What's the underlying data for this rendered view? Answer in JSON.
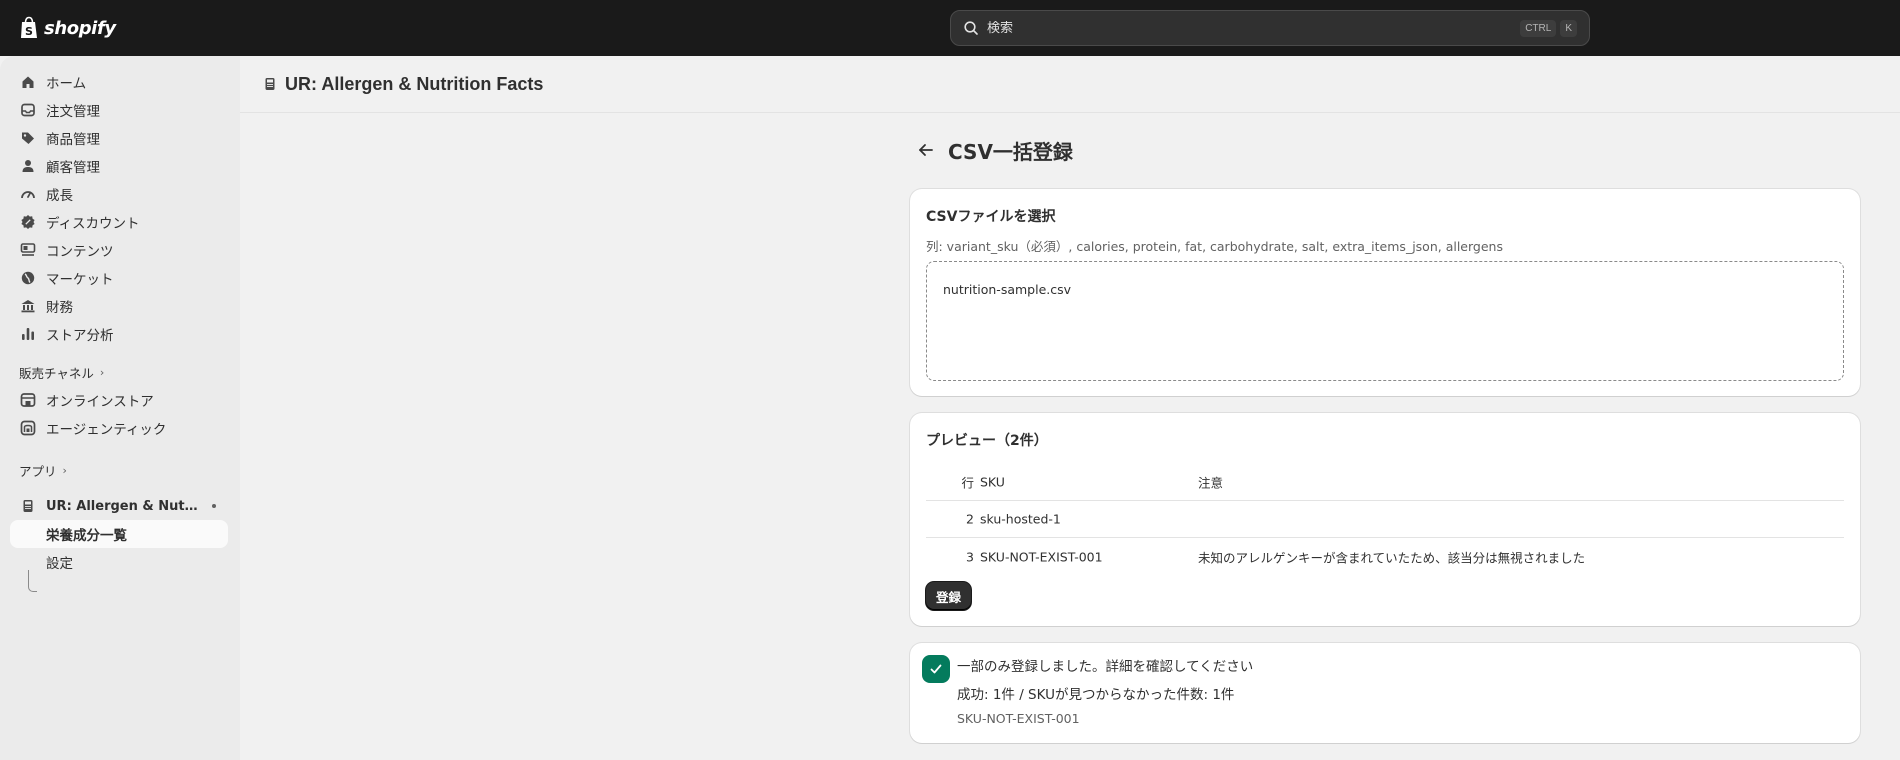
{
  "topbar": {
    "logo_text": "shopify",
    "search_placeholder": "検索",
    "shortcut_key1": "CTRL",
    "shortcut_key2": "K"
  },
  "sidebar": {
    "items": [
      {
        "label": "ホーム",
        "icon": "home-icon"
      },
      {
        "label": "注文管理",
        "icon": "inbox-icon"
      },
      {
        "label": "商品管理",
        "icon": "tag-icon"
      },
      {
        "label": "顧客管理",
        "icon": "person-icon"
      },
      {
        "label": "成長",
        "icon": "gauge-icon"
      },
      {
        "label": "ディスカウント",
        "icon": "discount-icon"
      },
      {
        "label": "コンテンツ",
        "icon": "content-icon"
      },
      {
        "label": "マーケット",
        "icon": "globe-icon"
      },
      {
        "label": "財務",
        "icon": "bank-icon"
      },
      {
        "label": "ストア分析",
        "icon": "bar-chart-icon"
      }
    ],
    "sales_channels_label": "販売チャネル",
    "channels": [
      {
        "label": "オンラインストア",
        "icon": "store-icon"
      },
      {
        "label": "エージェンティック",
        "icon": "agentic-icon"
      }
    ],
    "apps_label": "アプリ",
    "app": {
      "label": "UR: Allergen & Nutrition Facts",
      "icon": "app-icon"
    },
    "sub_items": [
      {
        "label": "栄養成分一覧"
      },
      {
        "label": "設定"
      }
    ]
  },
  "header": {
    "app_title": "UR: Allergen & Nutrition Facts"
  },
  "page": {
    "title": "CSV一括登録"
  },
  "upload_card": {
    "heading": "CSVファイルを選択",
    "columns_hint": "列: variant_sku（必須）, calories, protein, fat, carbohydrate, salt, extra_items_json, allergens",
    "file_name": "nutrition-sample.csv"
  },
  "preview_card": {
    "heading": "プレビュー（2件）",
    "columns": {
      "row": "行",
      "sku": "SKU",
      "note": "注意"
    },
    "rows": [
      {
        "row": "2",
        "sku": "sku-hosted-1",
        "note": ""
      },
      {
        "row": "3",
        "sku": "SKU-NOT-EXIST-001",
        "note": "未知のアレルゲンキーが含まれていたため、該当分は無視されました"
      }
    ],
    "register_label": "登録"
  },
  "result_card": {
    "title": "一部のみ登録しました。詳細を確認してください",
    "detail": "成功: 1件 / SKUが見つからなかった件数: 1件",
    "missing_sku": "SKU-NOT-EXIST-001"
  },
  "colors": {
    "topbar": "#1a1a1a",
    "success": "#047b5d",
    "primary_button": "#303030"
  }
}
